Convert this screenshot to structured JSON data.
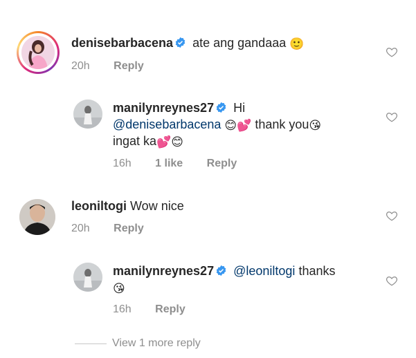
{
  "comments": [
    {
      "username": "denisebarbacena",
      "text": "ate ang gandaaa",
      "emoji_after": "🙂",
      "time": "20h",
      "reply_label": "Reply"
    },
    {
      "username": "manilynreynes27",
      "greeting": "Hi",
      "mention": "@denisebarbacena",
      "emoji_mid": "😊💕",
      "text": "thank you",
      "emoji_after": "😘",
      "line2": "ingat ka",
      "emoji_end": "💕😊",
      "time": "16h",
      "likes": "1 like",
      "reply_label": "Reply"
    },
    {
      "username": "leoniltogi",
      "text": "Wow nice",
      "time": "20h",
      "reply_label": "Reply"
    },
    {
      "username": "manilynreynes27",
      "mention": "@leoniltogi",
      "text": "thanks",
      "emoji_after": "😘",
      "time": "16h",
      "reply_label": "Reply"
    }
  ],
  "view_more": "View 1 more reply",
  "colors": {
    "verified_blue": "#3897f0",
    "mention": "#00376b",
    "muted": "#8e8e8e"
  }
}
